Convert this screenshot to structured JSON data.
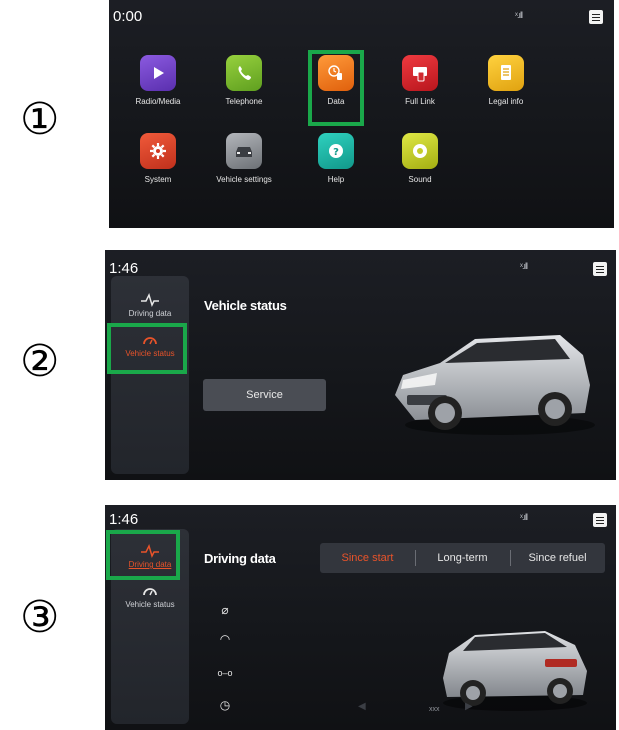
{
  "steps": [
    "①",
    "②",
    "③"
  ],
  "screen1": {
    "clock": "0:00",
    "signal": "ˣ.ıll",
    "apps": [
      {
        "label": "Radio/Media",
        "icon": "play-icon",
        "color": "#6b3fc2"
      },
      {
        "label": "Telephone",
        "icon": "phone-handset-icon",
        "color": "#79b82e"
      },
      {
        "label": "Data",
        "icon": "fuel-pump-icon",
        "color": "#f07a1c"
      },
      {
        "label": "Full Link",
        "icon": "phone-link-icon",
        "color": "#d8262c"
      },
      {
        "label": "Legal info",
        "icon": "document-icon",
        "color": "#f1b81a"
      },
      {
        "label": "System",
        "icon": "gear-icon",
        "color": "#d8452a"
      },
      {
        "label": "Vehicle settings",
        "icon": "car-front-icon",
        "color": "#8f9398"
      },
      {
        "label": "Help",
        "icon": "help-question-icon",
        "color": "#19b3a2"
      },
      {
        "label": "Sound",
        "icon": "speaker-icon",
        "color": "#c6d12a"
      }
    ],
    "highlight_color": "#1aa84a"
  },
  "screen2": {
    "clock": "1:46",
    "signal": "ˣ.ıll",
    "sidebar": [
      {
        "label": "Driving data",
        "icon": "pulse-line-icon",
        "active": false
      },
      {
        "label": "Vehicle status",
        "icon": "gauge-icon",
        "active": true
      }
    ],
    "heading": "Vehicle status",
    "service_label": "Service"
  },
  "screen3": {
    "clock": "1:46",
    "signal": "ˣ.ıll",
    "sidebar": [
      {
        "label": "Driving data",
        "icon": "pulse-line-icon",
        "active": true
      },
      {
        "label": "Vehicle status",
        "icon": "gauge-icon",
        "active": false
      }
    ],
    "heading": "Driving data",
    "tabs": [
      "Since start",
      "Long-term",
      "Since refuel"
    ],
    "active_tab": 0,
    "data_icons": [
      "⌀",
      "◠",
      "o–o",
      "◷"
    ],
    "data_icon_names": [
      "average-icon",
      "gauge-icon",
      "distance-icon",
      "clock-icon"
    ],
    "footnote": "xxx",
    "accent_color": "#e8532a"
  }
}
